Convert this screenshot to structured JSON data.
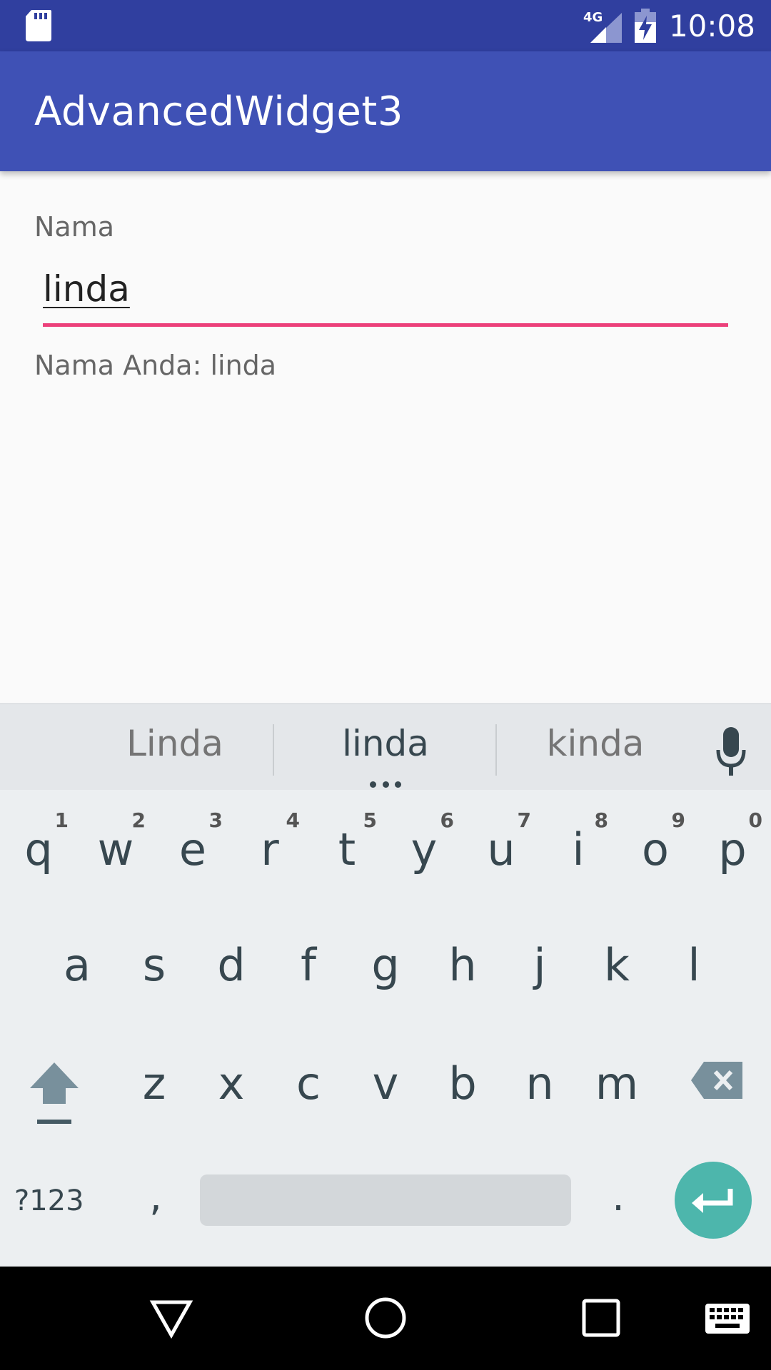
{
  "status_bar": {
    "time": "10:08",
    "network_label": "4G",
    "icons": [
      "sd-card-icon",
      "signal-icon",
      "battery-charging-icon"
    ]
  },
  "app_bar": {
    "title": "AdvancedWidget3"
  },
  "form": {
    "name_label": "Nama",
    "name_value": "linda",
    "result_text": "Nama Anda: linda",
    "accent_color": "#ec407a"
  },
  "keyboard": {
    "suggestions": [
      "Linda",
      "linda",
      "kinda"
    ],
    "row1": [
      {
        "key": "q",
        "hint": "1"
      },
      {
        "key": "w",
        "hint": "2"
      },
      {
        "key": "e",
        "hint": "3"
      },
      {
        "key": "r",
        "hint": "4"
      },
      {
        "key": "t",
        "hint": "5"
      },
      {
        "key": "y",
        "hint": "6"
      },
      {
        "key": "u",
        "hint": "7"
      },
      {
        "key": "i",
        "hint": "8"
      },
      {
        "key": "o",
        "hint": "9"
      },
      {
        "key": "p",
        "hint": "0"
      }
    ],
    "row2": [
      "a",
      "s",
      "d",
      "f",
      "g",
      "h",
      "j",
      "k",
      "l"
    ],
    "row3": [
      "z",
      "x",
      "c",
      "v",
      "b",
      "n",
      "m"
    ],
    "symbols_label": "?123",
    "comma_label": ",",
    "period_label": ".",
    "enter_color": "#4db6ac"
  },
  "colors": {
    "status_bar": "#303f9f",
    "app_bar": "#3f51b5",
    "keyboard_bg": "#eceff1"
  }
}
